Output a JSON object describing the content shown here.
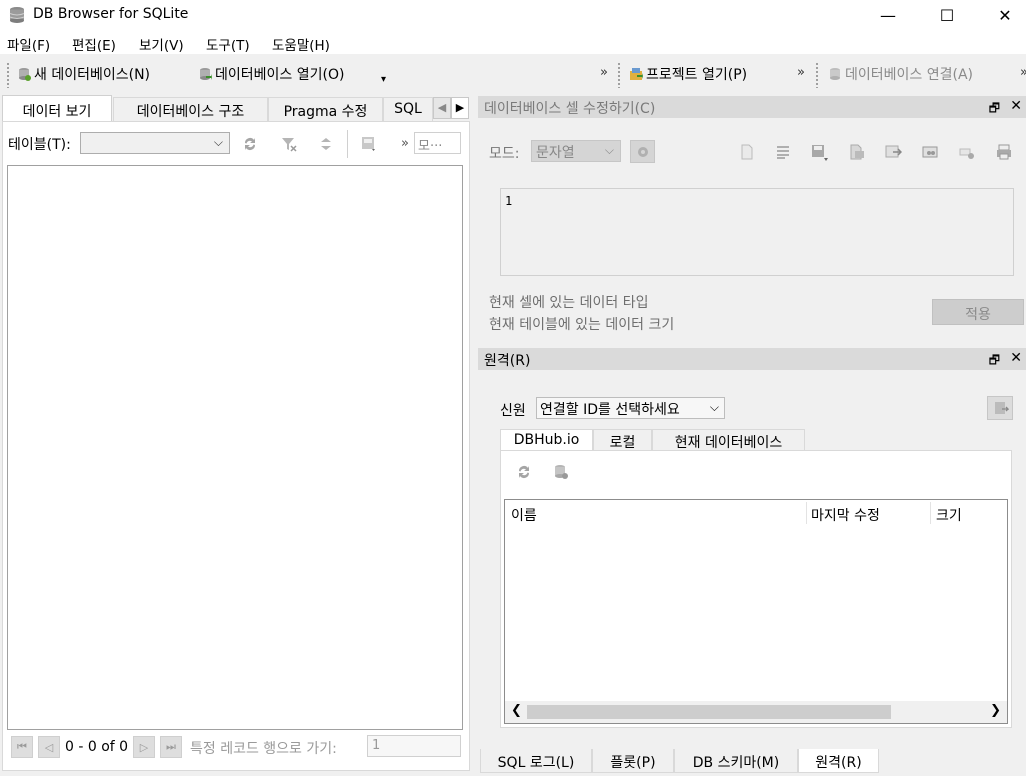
{
  "window": {
    "title": "DB Browser for SQLite",
    "minimize": "—",
    "maximize": "☐",
    "close": "✕"
  },
  "menu": [
    "파일(F)",
    "편집(E)",
    "보기(V)",
    "도구(T)",
    "도움말(H)"
  ],
  "toolbar": {
    "new_db": "새 데이터베이스(N)",
    "open_db": "데이터베이스 열기(O)",
    "open_project": "프로젝트 열기(P)",
    "attach_db": "데이터베이스 연결(A)",
    "overflow": "»",
    "dropdown": "▾"
  },
  "left_tabs": [
    "데이터 보기",
    "데이터베이스 구조",
    "Pragma 수정",
    "SQL"
  ],
  "browse": {
    "table_label": "테이블(T):",
    "table_value": "",
    "filter_placeholder": "모···",
    "overflow": "»",
    "record_count": "0 - 0 of 0",
    "goto_label": "특정 레코드 행으로 가기:",
    "goto_value": "1"
  },
  "edit_cell": {
    "title": "데이터베이스 셀 수정하기(C)",
    "mode_label": "모드:",
    "mode_value": "문자열",
    "content": "1",
    "type_info": "현재 셀에 있는 데이터 타입",
    "size_info": "현재 테이블에 있는 데이터 크기",
    "apply": "적용"
  },
  "remote": {
    "title": "원격(R)",
    "identity_label": "신원",
    "identity_value": "연결할 ID를 선택하세요",
    "tabs": [
      "DBHub.io",
      "로컬",
      "현재 데이터베이스"
    ],
    "columns": [
      "이름",
      "마지막 수정",
      "크기"
    ]
  },
  "bottom_tabs": [
    "SQL 로그(L)",
    "플롯(P)",
    "DB 스키마(M)",
    "원격(R)"
  ],
  "icons": {
    "refresh": "refresh-icon",
    "clear_filter": "clear-filters-icon",
    "save_table": "save-icon",
    "print": "print-icon"
  }
}
